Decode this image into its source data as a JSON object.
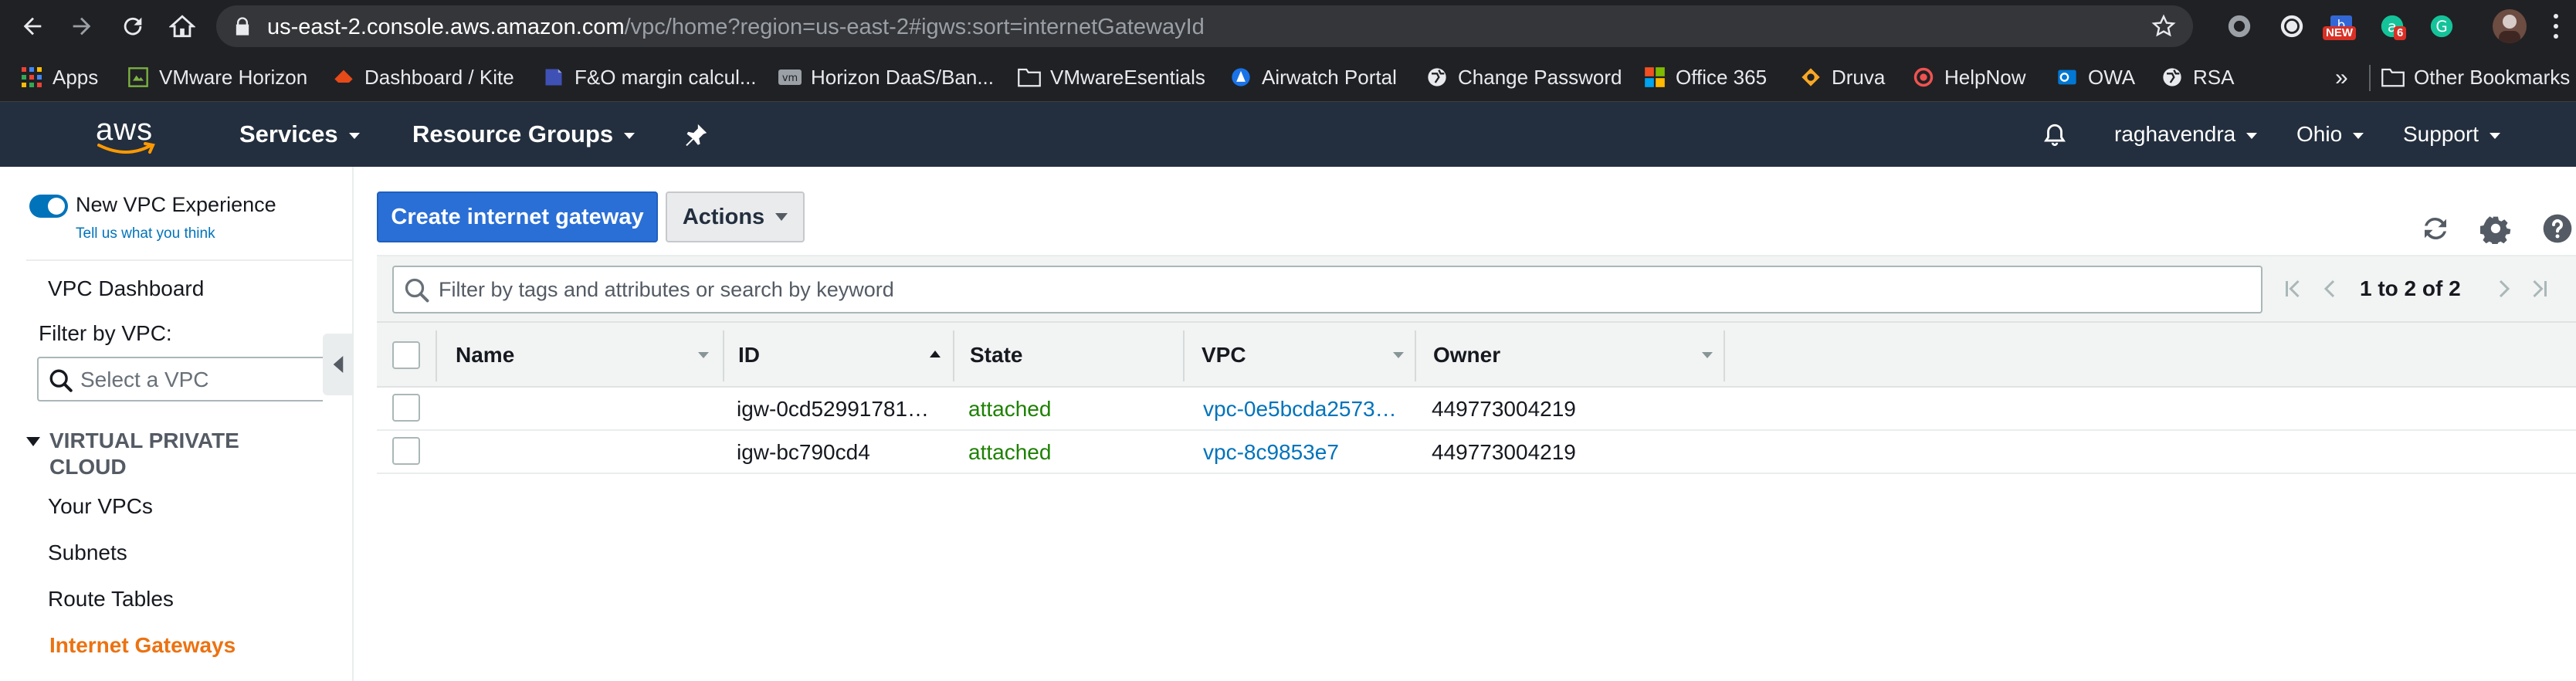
{
  "browser": {
    "url_host": "us-east-2.console.aws.amazon.com",
    "url_path": "/vpc/home?region=us-east-2#igws:sort=internetGatewayId",
    "extensions": [
      {
        "name": "record-icon",
        "badge": ""
      },
      {
        "name": "circle-icon",
        "badge": ""
      },
      {
        "name": "new-ext-icon",
        "badge": "NEW"
      },
      {
        "name": "grammarly-badge-icon",
        "badge": "6"
      },
      {
        "name": "grammarly-icon",
        "badge": ""
      }
    ]
  },
  "bookmarks": {
    "items": [
      "Apps",
      "VMware Horizon",
      "Dashboard / Kite",
      "F&O margin calcul...",
      "Horizon DaaS/Ban...",
      "VMwareEsentials",
      "Airwatch Portal",
      "Change Password",
      "Office 365",
      "Druva",
      "HelpNow",
      "OWA",
      "RSA"
    ],
    "more": "»",
    "other": "Other Bookmarks"
  },
  "aws_nav": {
    "logo": "aws",
    "services": "Services",
    "resource_groups": "Resource Groups",
    "user": "raghavendra",
    "region": "Ohio",
    "support": "Support"
  },
  "sidebar": {
    "new_vpc_experience": "New VPC Experience",
    "tell_us": "Tell us what you think",
    "vpc_dashboard": "VPC Dashboard",
    "filter_label": "Filter by VPC:",
    "select_placeholder": "Select a VPC",
    "section_title": "VIRTUAL PRIVATE CLOUD",
    "items": [
      "Your VPCs",
      "Subnets",
      "Route Tables",
      "Internet Gateways"
    ]
  },
  "main": {
    "create_button": "Create internet gateway",
    "actions_button": "Actions",
    "filter_placeholder": "Filter by tags and attributes or search by keyword",
    "pager": "1 to 2 of 2",
    "columns": [
      "Name",
      "ID",
      "State",
      "VPC",
      "Owner"
    ],
    "rows": [
      {
        "name": "",
        "id": "igw-0cd52991781…",
        "state": "attached",
        "vpc": "vpc-0e5bcda2573…",
        "owner": "449773004219"
      },
      {
        "name": "",
        "id": "igw-bc790cd4",
        "state": "attached",
        "vpc": "vpc-8c9853e7",
        "owner": "449773004219"
      }
    ]
  },
  "colors": {
    "aws_nav_bg": "#232f3e",
    "primary_button": "#2a6fd6",
    "active_link": "#ec7211",
    "state_ok": "#1d8102",
    "link": "#0073bb"
  }
}
